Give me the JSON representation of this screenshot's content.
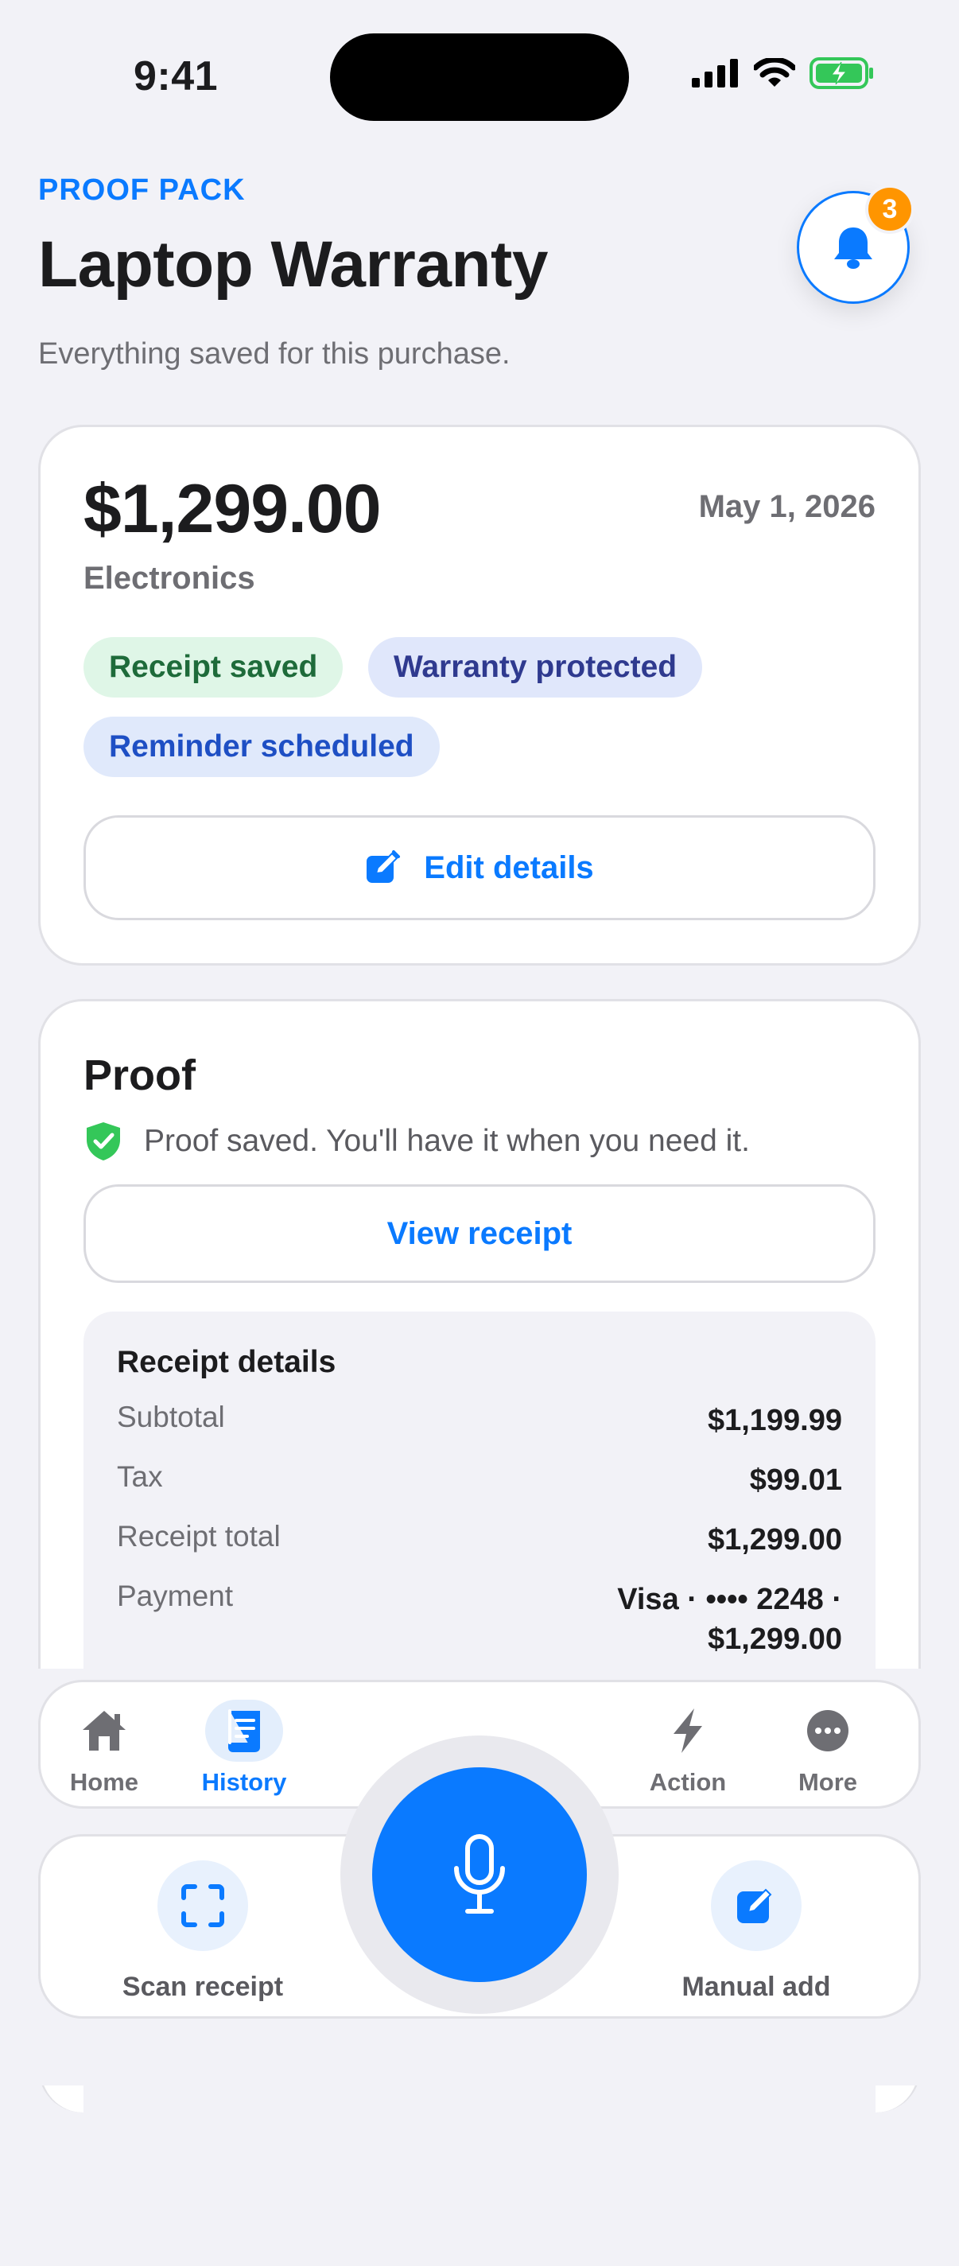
{
  "status_bar": {
    "time": "9:41"
  },
  "header": {
    "eyebrow": "PROOF PACK",
    "title": "Laptop Warranty",
    "subtitle": "Everything saved for this purchase.",
    "notification_count": "3"
  },
  "summary": {
    "amount": "$1,299.00",
    "date": "May 1, 2026",
    "category": "Electronics",
    "chips": [
      "Receipt saved",
      "Warranty protected",
      "Reminder scheduled"
    ],
    "edit_label": "Edit details"
  },
  "proof": {
    "title": "Proof",
    "note": "Proof saved. You'll have it when you need it.",
    "view_label": "View receipt",
    "receipt": {
      "heading": "Receipt details",
      "rows": [
        {
          "label": "Subtotal",
          "value": "$1,199.99"
        },
        {
          "label": "Tax",
          "value": "$99.01"
        },
        {
          "label": "Receipt total",
          "value": "$1,299.00"
        },
        {
          "label": "Payment",
          "value": "Visa · •••• 2248 ·",
          "value2": "$1,299.00"
        }
      ]
    }
  },
  "tabs": [
    {
      "label": "Home",
      "icon": "house-icon"
    },
    {
      "label": "History",
      "icon": "receipt-icon",
      "active": true
    },
    {
      "label": "Action",
      "icon": "bolt-icon"
    },
    {
      "label": "More",
      "icon": "ellipsis-icon"
    }
  ],
  "actions": {
    "scan_label": "Scan receipt",
    "manual_label": "Manual add"
  },
  "colors": {
    "accent": "#0A7AFF",
    "badge": "#FF9500",
    "success": "#34C759"
  }
}
